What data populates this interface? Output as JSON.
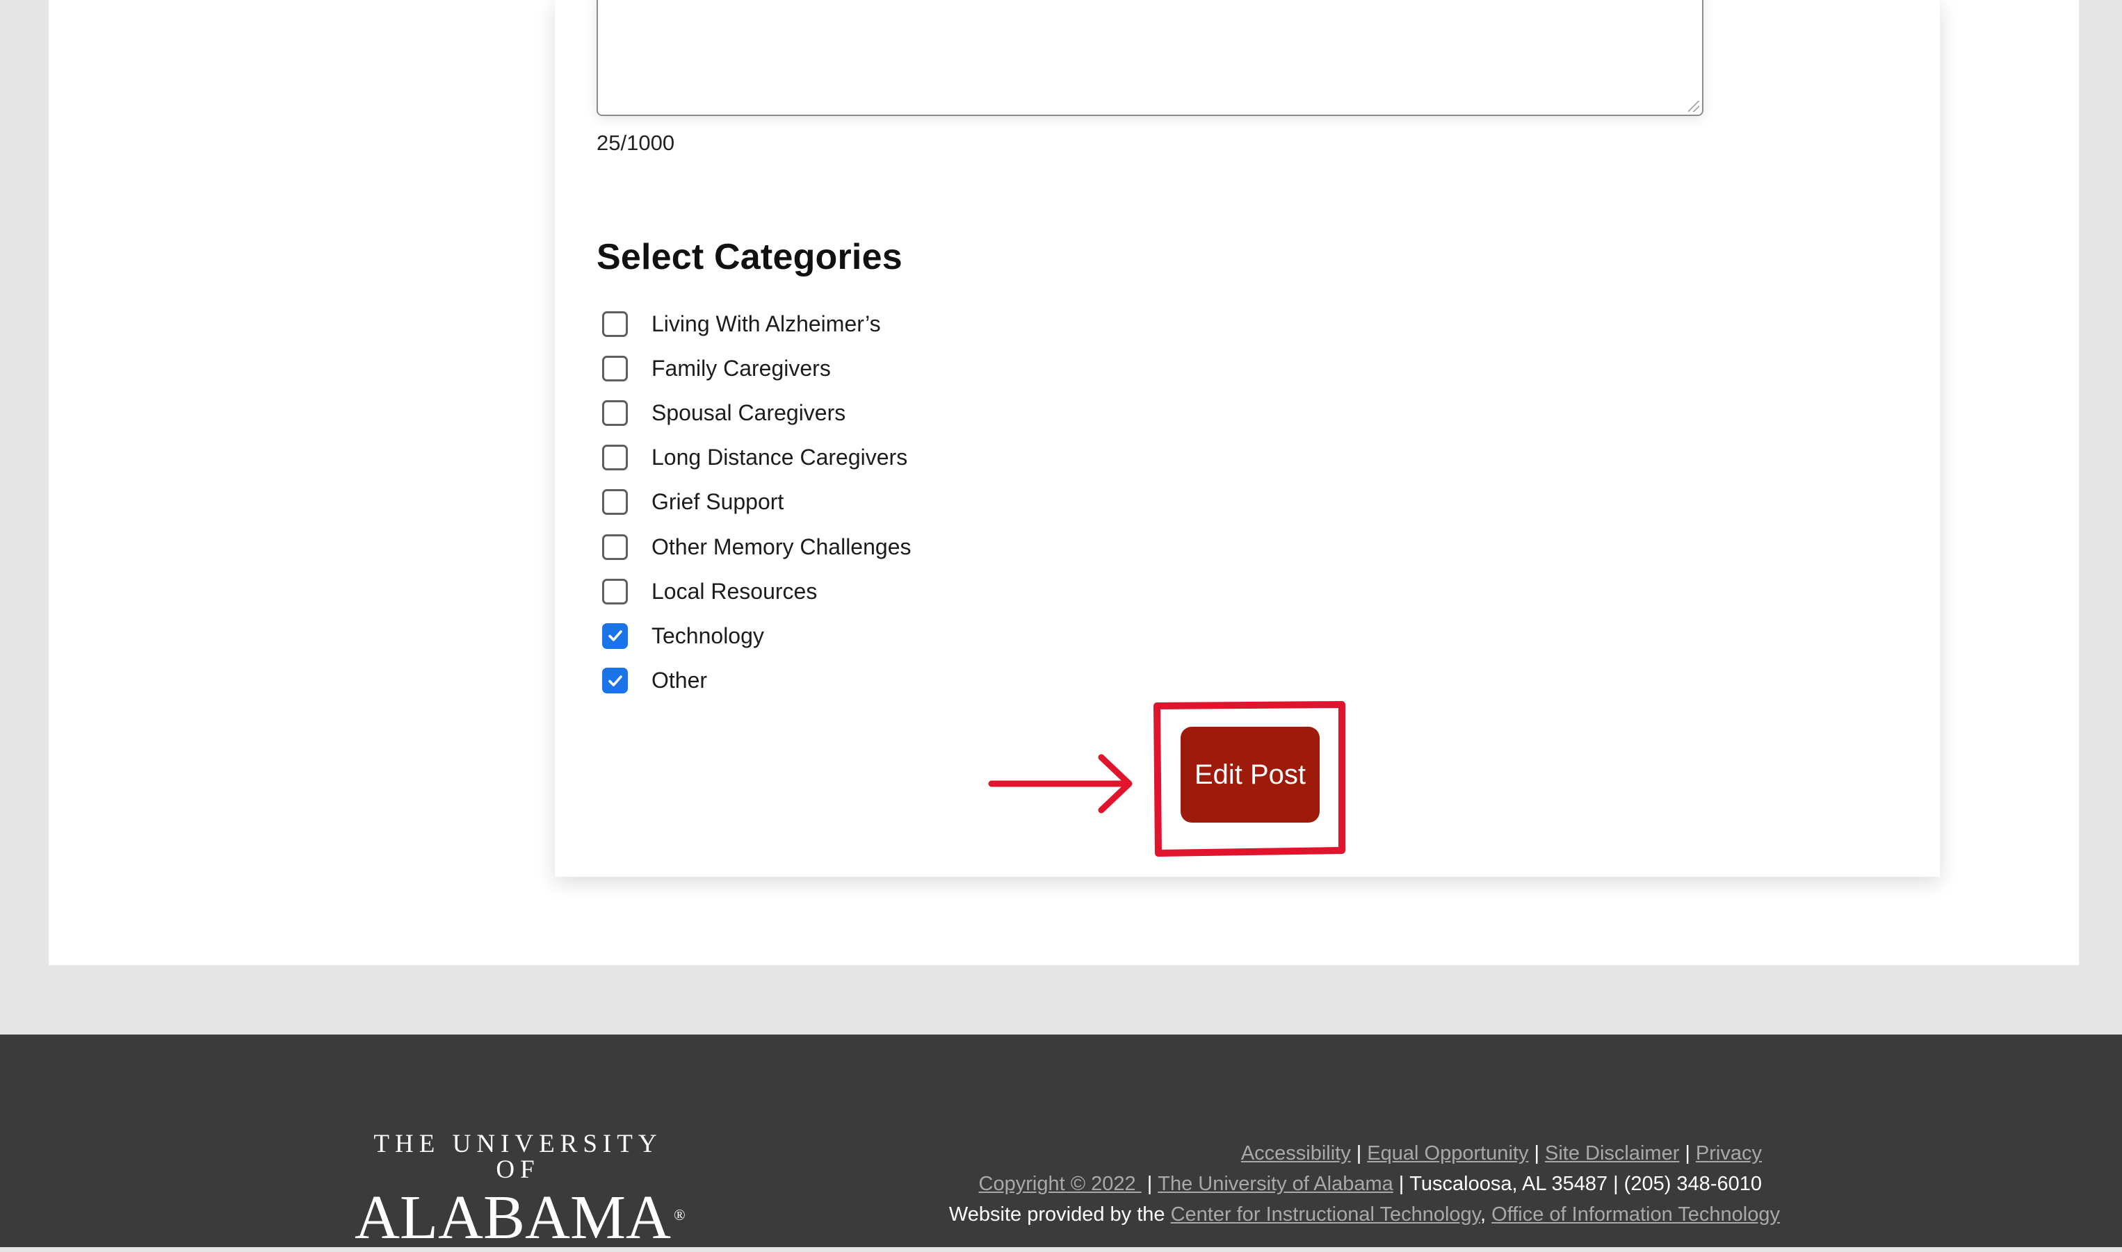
{
  "form": {
    "char_count": "25/1000",
    "categories_title": "Select Categories",
    "categories": [
      {
        "label": "Living With Alzheimer’s",
        "checked": false
      },
      {
        "label": "Family Caregivers",
        "checked": false
      },
      {
        "label": "Spousal Caregivers",
        "checked": false
      },
      {
        "label": "Long Distance Caregivers",
        "checked": false
      },
      {
        "label": "Grief Support",
        "checked": false
      },
      {
        "label": "Other Memory Challenges",
        "checked": false
      },
      {
        "label": "Local Resources",
        "checked": false
      },
      {
        "label": "Technology",
        "checked": true
      },
      {
        "label": "Other",
        "checked": true
      }
    ],
    "submit_label": "Edit Post"
  },
  "footer": {
    "logo_top": "THE UNIVERSITY OF",
    "logo_main": "ALABAMA",
    "logo_reg": "®",
    "links": {
      "accessibility": "Accessibility",
      "equal_opportunity": "Equal Opportunity",
      "site_disclaimer": "Site Disclaimer",
      "privacy": "Privacy",
      "copyright": "Copyright © 2022 ",
      "university": "The University of Alabama",
      "cit": "Center for Instructional Technology",
      "oit": "Office of Information Technology"
    },
    "separator": "|",
    "address": "Tuscaloosa, AL 35487",
    "phone": "(205) 348-6010",
    "provided_by": "Website provided by the",
    "comma": ","
  },
  "colors": {
    "button": "#9e1b0b",
    "annotation": "#e0142c",
    "checkbox_checked": "#1a73e8",
    "footer_bg": "#3b3b3b",
    "page_bg": "#e6e6e6"
  },
  "icons": {
    "check": "checkmark-icon",
    "arrow": "arrow-right-icon",
    "resize": "resize-grip-icon"
  }
}
